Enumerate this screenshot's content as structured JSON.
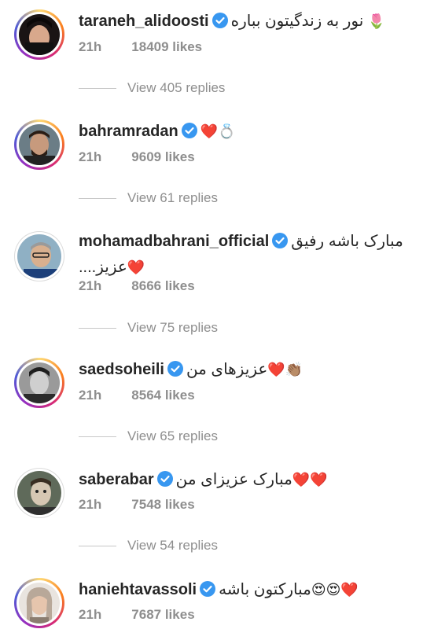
{
  "comments": [
    {
      "username": "taraneh_alidoosti",
      "text": "نور به زندگیتون بباره",
      "emoji": "🌷",
      "time": "21h",
      "likes": "18409 likes",
      "replies": "View 405 replies"
    },
    {
      "username": "bahramradan",
      "text": "",
      "emoji": "❤️💍",
      "time": "21h",
      "likes": "9609 likes",
      "replies": "View 61 replies"
    },
    {
      "username": "mohamadbahrani_official",
      "text": "مبارک باشه رفیق",
      "text2": "عزیز....",
      "emoji": "❤️",
      "time": "21h",
      "likes": "8666 likes",
      "replies": "View 75 replies"
    },
    {
      "username": "saedsoheili",
      "text": "عزیزهای من",
      "emoji": "❤️👏🏽",
      "time": "21h",
      "likes": "8564 likes",
      "replies": "View 65 replies"
    },
    {
      "username": "saberabar",
      "text": "مبارک عزیزای من",
      "emoji": "❤️❤️",
      "time": "21h",
      "likes": "7548 likes",
      "replies": "View 54 replies"
    },
    {
      "username": "haniehtavassoli",
      "text": "مبارکتون باشه",
      "emoji": "😍😍❤️",
      "time": "21h",
      "likes": "7687 likes"
    }
  ],
  "colors": {
    "verified": "#3897f0",
    "heart": "#ed4956"
  }
}
